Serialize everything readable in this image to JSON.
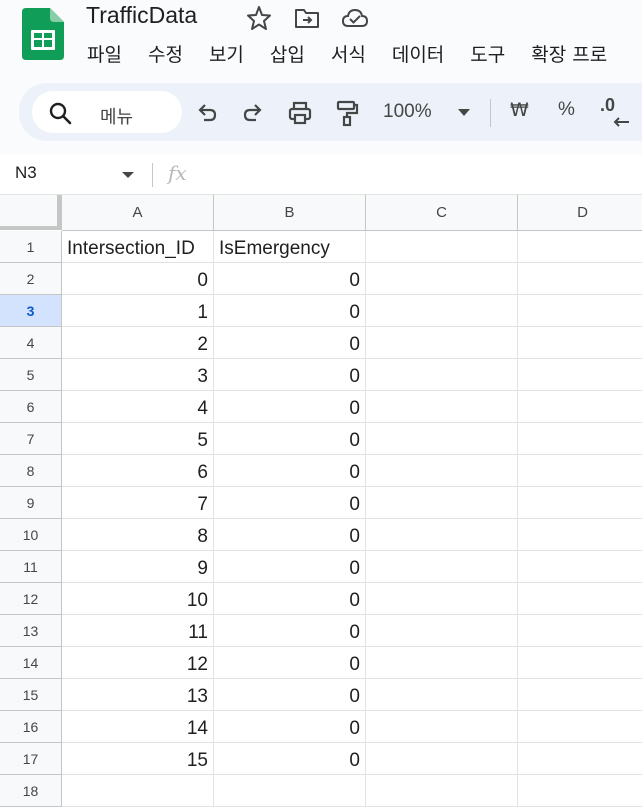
{
  "app": {
    "title": "TrafficData",
    "accent": "#0f9d58"
  },
  "menu": [
    "파일",
    "수정",
    "보기",
    "삽입",
    "서식",
    "데이터",
    "도구",
    "확장 프로"
  ],
  "toolbar": {
    "search_label": "메뉴",
    "zoom": "100%",
    "currency": "₩",
    "percent": "%",
    "decimal": ".0"
  },
  "formula_bar": {
    "cell_ref": "N3",
    "fx": "fx",
    "content": ""
  },
  "columns": [
    "A",
    "B",
    "C",
    "D"
  ],
  "rows": [
    {
      "num": "1",
      "a": "Intersection_ID",
      "b": "IsEmergency"
    },
    {
      "num": "2",
      "a": "0",
      "b": "0"
    },
    {
      "num": "3",
      "a": "1",
      "b": "0"
    },
    {
      "num": "4",
      "a": "2",
      "b": "0"
    },
    {
      "num": "5",
      "a": "3",
      "b": "0"
    },
    {
      "num": "6",
      "a": "4",
      "b": "0"
    },
    {
      "num": "7",
      "a": "5",
      "b": "0"
    },
    {
      "num": "8",
      "a": "6",
      "b": "0"
    },
    {
      "num": "9",
      "a": "7",
      "b": "0"
    },
    {
      "num": "10",
      "a": "8",
      "b": "0"
    },
    {
      "num": "11",
      "a": "9",
      "b": "0"
    },
    {
      "num": "12",
      "a": "10",
      "b": "0"
    },
    {
      "num": "13",
      "a": "11",
      "b": "0"
    },
    {
      "num": "14",
      "a": "12",
      "b": "0"
    },
    {
      "num": "15",
      "a": "13",
      "b": "0"
    },
    {
      "num": "16",
      "a": "14",
      "b": "0"
    },
    {
      "num": "17",
      "a": "15",
      "b": "0"
    },
    {
      "num": "18",
      "a": "",
      "b": ""
    }
  ],
  "active_row": "3"
}
